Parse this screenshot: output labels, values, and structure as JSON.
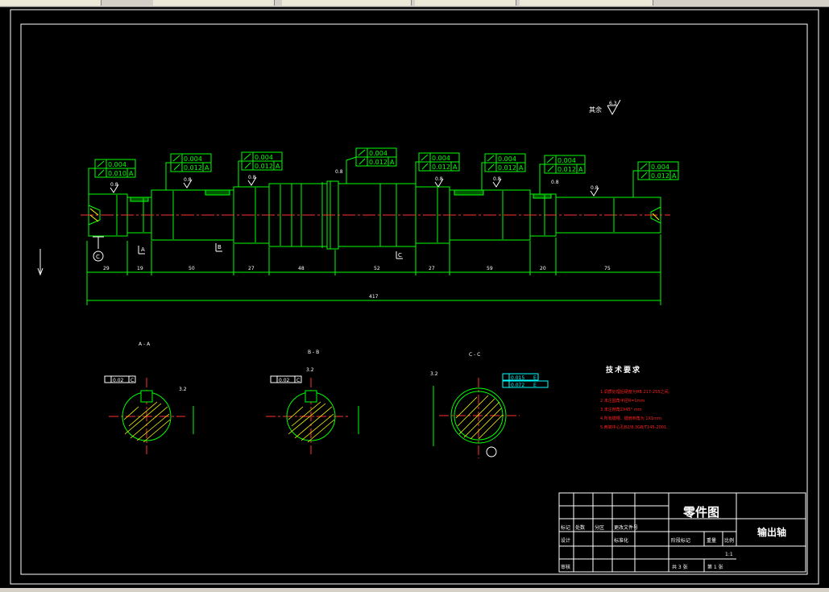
{
  "window": {
    "tabs": [
      "",
      "",
      "",
      "",
      ""
    ]
  },
  "colors": {
    "background": "#000000",
    "frame": "#ffffff",
    "outline": "#00ff00",
    "dimension": "#00ff00",
    "annotation": "#ffff00",
    "center_line": "#ff3333",
    "datum": "#00ffff",
    "requirement_text": "#ff2020"
  },
  "drawing": {
    "roughness_note": {
      "prefix": "其余",
      "value": "6.3"
    },
    "tolerance_frames": [
      {
        "row1": "0.004",
        "row2": "0.010",
        "datum": "A"
      },
      {
        "row1": "0.004",
        "row2": "0.012",
        "datum": "A"
      },
      {
        "row1": "0.004",
        "row2": "0.012",
        "datum": "A"
      },
      {
        "row1": "0.004",
        "row2": "0.012",
        "datum": "A"
      },
      {
        "row1": "0.004",
        "row2": "0.012",
        "datum": "A"
      },
      {
        "row1": "0.004",
        "row2": "0.012",
        "datum": "A"
      },
      {
        "row1": "0.004",
        "row2": "0.012",
        "datum": "A"
      },
      {
        "row1": "0.004",
        "row2": "0.012",
        "datum": "A"
      }
    ],
    "roughness_marks": [
      "0.8",
      "0.8",
      "0.8",
      "0.8",
      "0.8",
      "0.8",
      "0.8",
      "0.8"
    ],
    "segment_lengths": [
      "29",
      "19",
      "50",
      "27",
      "48",
      "52",
      "27",
      "59",
      "20",
      "75"
    ],
    "total_length": "417",
    "section_marks": [
      "A",
      "B",
      "C"
    ],
    "center_mark": "C"
  },
  "sections": {
    "a": {
      "title": "A - A",
      "tolerance": "0.02",
      "datum": "C",
      "roughness": "3.2"
    },
    "b": {
      "title": "B - B",
      "tolerance": "0.02",
      "datum": "C",
      "roughness": "3.2"
    },
    "c": {
      "title": "C - C",
      "tolerance_1": "0.015",
      "datum_1": "E",
      "tolerance_2": "0.072",
      "datum_2": "E",
      "roughness": "3.2"
    }
  },
  "requirements": {
    "title": "技术要求",
    "items": [
      "1.调质处理后硬度为HB 217-255之间。",
      "2.未注圆角半径R=1mm",
      "3.未注倒角2X45° mm",
      "4.所有键槽、键肩倒角为 1X1mm",
      "5.两端中心孔B2/8.3GB/T145-2001."
    ]
  },
  "title_block": {
    "drawing_type": "零件图",
    "part_name": "输出轴",
    "row1_labels": [
      "标记",
      "处数",
      "分区",
      "更改文件号"
    ],
    "row2_labels": [
      "设计",
      "",
      "",
      "标准化"
    ],
    "row4_labels": [
      "审核"
    ],
    "stage_labels": [
      "阶段标记",
      "重量",
      "比例"
    ],
    "scale": "1:1",
    "total_sheets": "共 3 张",
    "sheet_no": "第 1 张"
  }
}
